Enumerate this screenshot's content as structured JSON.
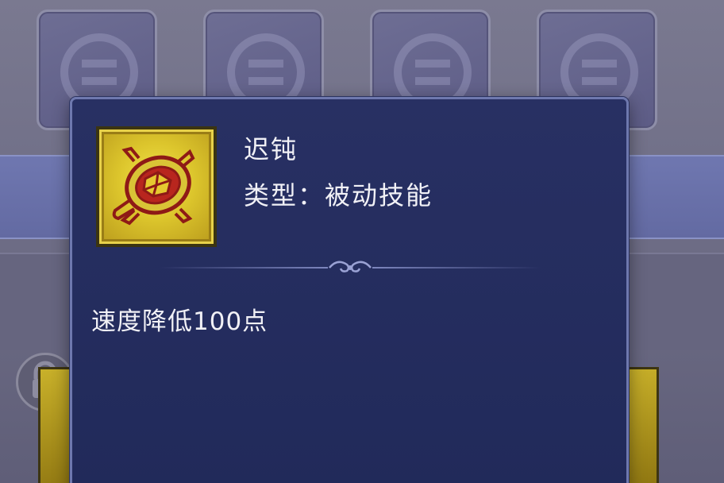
{
  "skill": {
    "name": "迟钝",
    "type_line": "类型：被动技能",
    "description": "速度降低100点",
    "icon": "turtle-icon"
  },
  "colors": {
    "panel_bg": "#252d5e",
    "panel_border": "#6e78ae",
    "icon_gold": "#dcc52c",
    "icon_detail": "#8e1a16",
    "text": "#f1f1f6"
  }
}
